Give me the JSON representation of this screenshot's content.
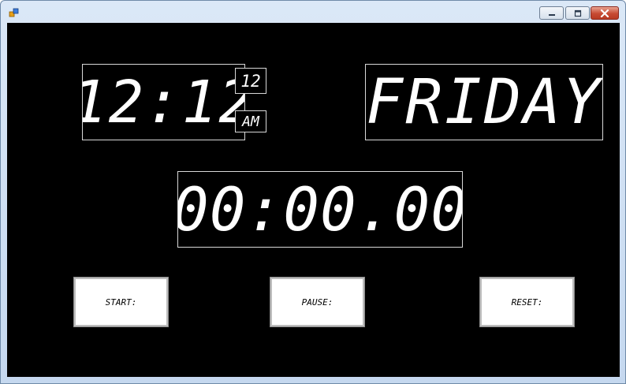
{
  "window": {
    "titlebar_color": "#c5d8ef",
    "icons": {
      "app": "app-icon",
      "minimize": "minimize-icon",
      "maximize": "maximize-icon",
      "close": "close-icon"
    }
  },
  "clock": {
    "time": "12:12",
    "format": "12",
    "period": "AM"
  },
  "day": {
    "name": "FRIDAY"
  },
  "stopwatch": {
    "elapsed": "00:00.00"
  },
  "controls": {
    "start_label": "START:",
    "pause_label": "PAUSE:",
    "reset_label": "RESET:"
  },
  "colors": {
    "background": "#000000",
    "digits": "#ffffff",
    "box_border": "#d8d8d8",
    "button_face": "#ffffff"
  }
}
